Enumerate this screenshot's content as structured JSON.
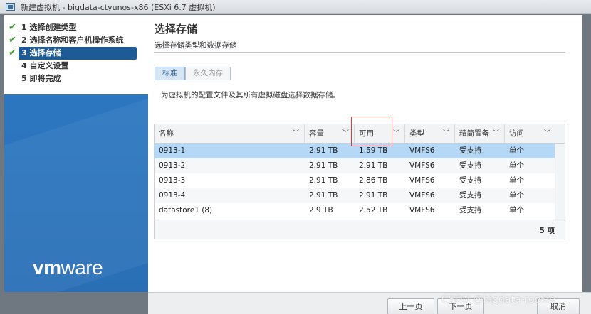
{
  "window": {
    "title": "新建虚拟机 - bigdata-ctyunos-x86 (ESXi 6.7 虚拟机)"
  },
  "wizard_steps": [
    {
      "label": "1 选择创建类型",
      "done": true
    },
    {
      "label": "2 选择名称和客户机操作系统",
      "done": true
    },
    {
      "label": "3 选择存储",
      "done": true,
      "active": true
    },
    {
      "label": "4 自定义设置",
      "done": false
    },
    {
      "label": "5 即将完成",
      "done": false
    }
  ],
  "brand": {
    "logo_text_bold": "vm",
    "logo_text_rest": "ware"
  },
  "page": {
    "title": "选择存储",
    "subtitle": "选择存储类型和数据存储",
    "tabs": [
      "标准",
      "永久内存"
    ],
    "active_tab": "标准",
    "description": "为虚拟机的配置文件及其所有虚拟磁盘选择数据存储。"
  },
  "table": {
    "columns": [
      "名称",
      "容量",
      "可用",
      "类型",
      "精简置备",
      "访问"
    ],
    "rows": [
      [
        "0913-1",
        "2.91 TB",
        "1.59 TB",
        "VMFS6",
        "受支持",
        "单个"
      ],
      [
        "0913-2",
        "2.91 TB",
        "2.91 TB",
        "VMFS6",
        "受支持",
        "单个"
      ],
      [
        "0913-3",
        "2.91 TB",
        "2.86 TB",
        "VMFS6",
        "受支持",
        "单个"
      ],
      [
        "0913-4",
        "2.91 TB",
        "2.91 TB",
        "VMFS6",
        "受支持",
        "单个"
      ],
      [
        "datastore1 (8)",
        "2.9 TB",
        "2.52 TB",
        "VMFS6",
        "受支持",
        "单个"
      ]
    ],
    "selected_row": 0,
    "item_count": "5 项"
  },
  "footer": {
    "prev_label": "上一页",
    "next_label": "下一页",
    "cancel_label": "取消"
  },
  "watermark": "CSDN @bigdata-rookie",
  "colors": {
    "accent": "#2d7ac5",
    "selection": "#b4d8f5",
    "annotation": "#e53a3a"
  }
}
